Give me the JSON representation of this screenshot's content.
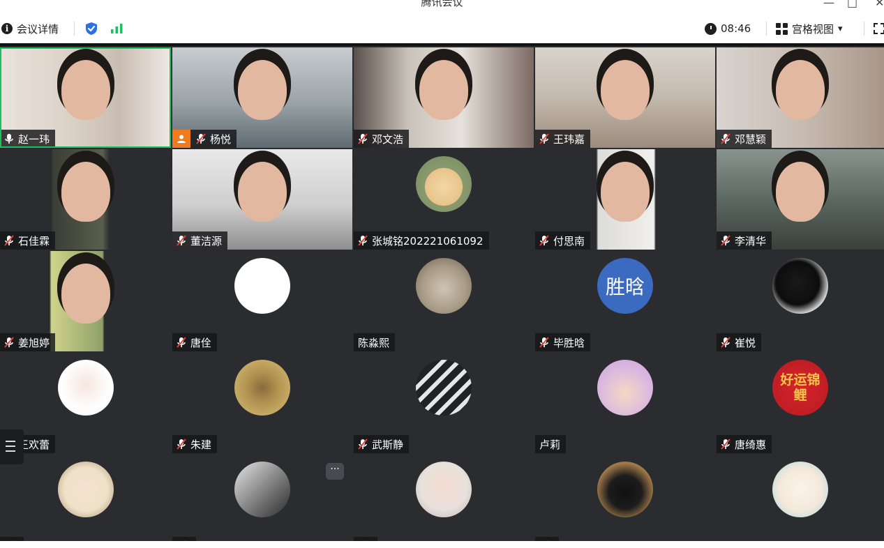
{
  "window": {
    "title": "腾讯会议",
    "minimize_glyph": "—",
    "maximize_glyph": "□",
    "close_glyph": "✕"
  },
  "toolbar": {
    "meeting_info_label": "会议详情",
    "shield_icon": "shield-check-icon",
    "signal_icon": "signal-bars-icon",
    "time": "08:46",
    "view_label": "宫格视图",
    "view_arrow": "▾",
    "fullscreen_icon": "fullscreen-icon"
  },
  "colors": {
    "tile_bg": "#2b2c30",
    "active_speaker": "#1fbf5f",
    "shield": "#2a6ee8",
    "signal": "#1fbf5f",
    "host_badge": "#f07b1e",
    "name_avatar": "#3b6bc0"
  },
  "participants": [
    {
      "name": "赵一玮",
      "mic": "on",
      "kind": "video",
      "active": true
    },
    {
      "name": "杨悦",
      "mic": "muted",
      "kind": "video",
      "host": true
    },
    {
      "name": "邓文浩",
      "mic": "muted",
      "kind": "video"
    },
    {
      "name": "王玮嘉",
      "mic": "muted",
      "kind": "video"
    },
    {
      "name": "邓慧颖",
      "mic": "muted",
      "kind": "video"
    },
    {
      "name": "石佳霖",
      "mic": "muted",
      "kind": "video"
    },
    {
      "name": "董洁源",
      "mic": "muted",
      "kind": "video"
    },
    {
      "name": "张城铭202221061092",
      "mic": "muted",
      "kind": "avatar",
      "avatar": "bear-bowtie"
    },
    {
      "name": "付思南",
      "mic": "muted",
      "kind": "video"
    },
    {
      "name": "李清华",
      "mic": "muted",
      "kind": "video"
    },
    {
      "name": "姜旭婷",
      "mic": "muted",
      "kind": "video"
    },
    {
      "name": "唐佺",
      "mic": "muted",
      "kind": "avatar",
      "avatar": "blank-white"
    },
    {
      "name": "陈淼熙",
      "mic": "none",
      "kind": "avatar",
      "avatar": "fluffy-cat"
    },
    {
      "name": "毕胜晗",
      "mic": "muted",
      "kind": "avatar",
      "avatar": "text",
      "avatar_text": "胜晗"
    },
    {
      "name": "崔悦",
      "mic": "muted",
      "kind": "avatar",
      "avatar": "black-bird"
    },
    {
      "name": "王欢蕾",
      "mic": "muted",
      "kind": "avatar",
      "avatar": "cartoon-girl"
    },
    {
      "name": "朱建",
      "mic": "muted",
      "kind": "avatar",
      "avatar": "owl-bird"
    },
    {
      "name": "武斯静",
      "mic": "muted",
      "kind": "avatar",
      "avatar": "crosswalk"
    },
    {
      "name": "卢莉",
      "mic": "none",
      "kind": "avatar",
      "avatar": "cartoon-cloud-girl"
    },
    {
      "name": "唐绮惠",
      "mic": "muted",
      "kind": "avatar",
      "avatar": "lucky-koi",
      "avatar_text": "好运锦鲤"
    },
    {
      "name": "",
      "mic": "muted",
      "kind": "avatar",
      "avatar": "cartoon-boy"
    },
    {
      "name": "",
      "mic": "muted",
      "kind": "avatar",
      "avatar": "bw-portrait",
      "more": "···"
    },
    {
      "name": "",
      "mic": "muted",
      "kind": "avatar",
      "avatar": "baby-girl"
    },
    {
      "name": "",
      "mic": "muted",
      "kind": "avatar",
      "avatar": "penguin"
    },
    {
      "name": "",
      "mic": "none",
      "kind": "avatar",
      "avatar": "cartoon-bear"
    }
  ]
}
